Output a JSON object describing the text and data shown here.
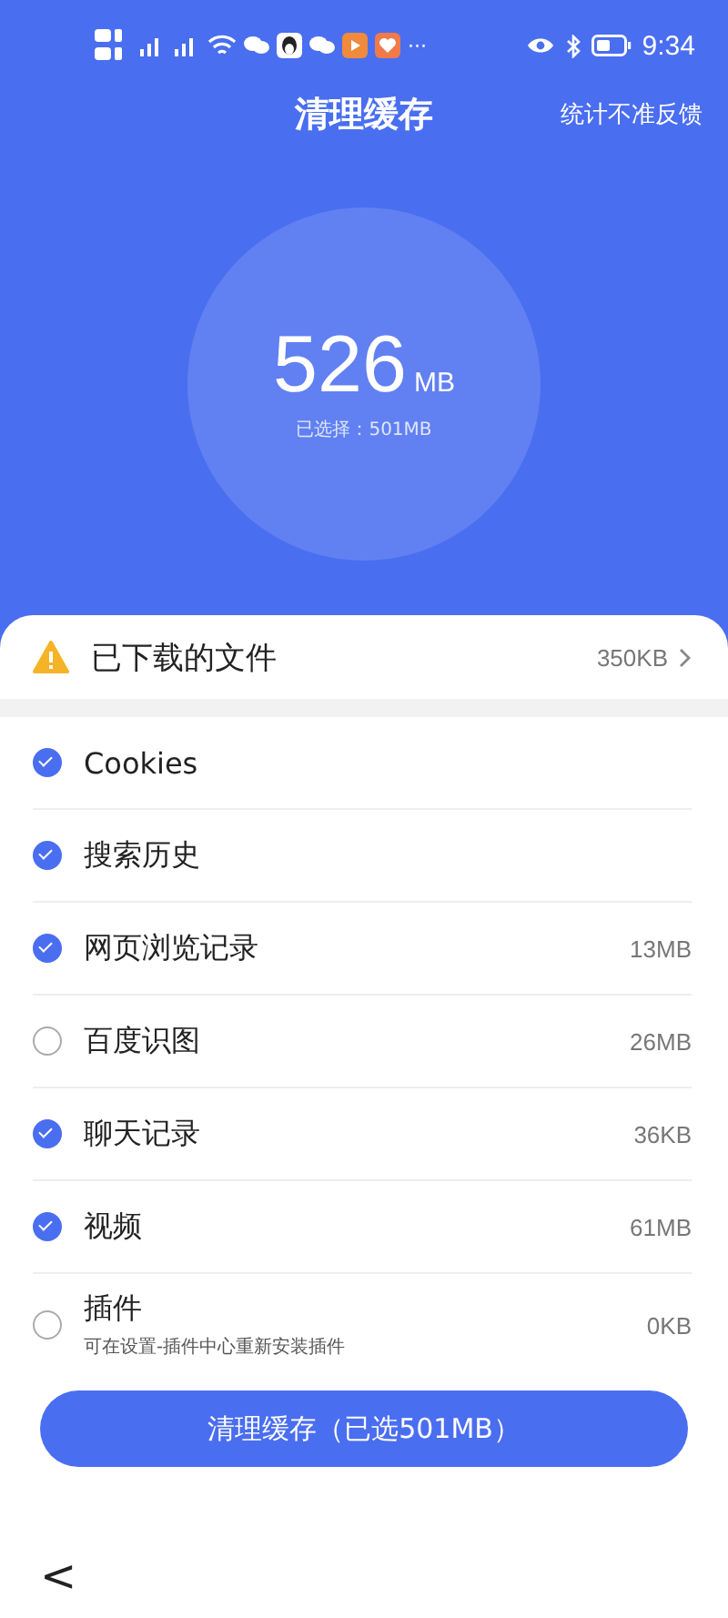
{
  "status_bar": {
    "more": "···",
    "time": "9:34"
  },
  "header": {
    "title": "清理缓存",
    "feedback": "统计不准反馈"
  },
  "summary": {
    "amount": "526",
    "unit": "MB",
    "selected": "已选择：501MB"
  },
  "downloads": {
    "label": "已下载的文件",
    "size": "350KB"
  },
  "items": [
    {
      "label": "Cookies",
      "checked": true
    },
    {
      "label": "搜索历史",
      "checked": true
    },
    {
      "label": "网页浏览记录",
      "checked": true,
      "size": "13MB"
    },
    {
      "label": "百度识图",
      "checked": false,
      "size": "26MB"
    },
    {
      "label": "聊天记录",
      "checked": true,
      "size": "36KB"
    },
    {
      "label": "视频",
      "checked": true,
      "size": "61MB"
    },
    {
      "label": "插件",
      "checked": false,
      "size": "0KB",
      "note": "可在设置-插件中心重新安装插件"
    }
  ],
  "clean_button": "清理缓存（已选501MB）",
  "nav": {
    "back": "<"
  }
}
